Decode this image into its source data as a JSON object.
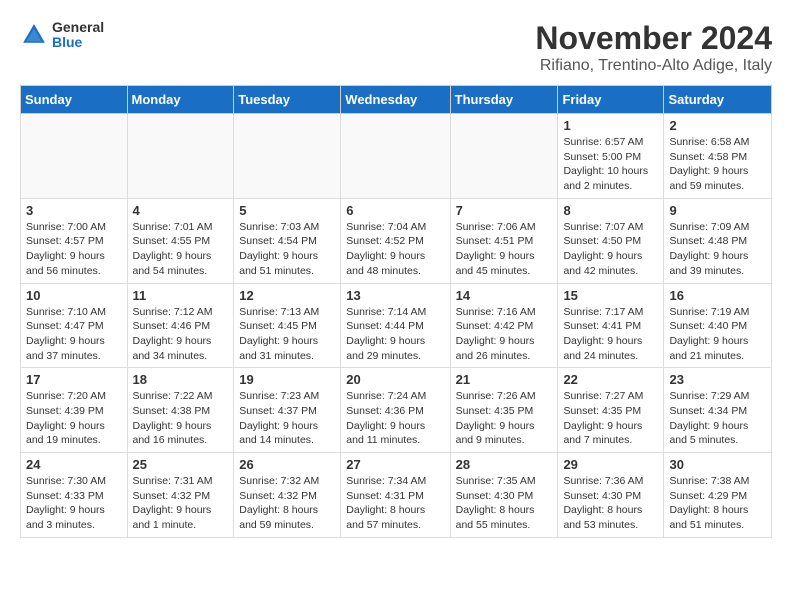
{
  "header": {
    "logo_general": "General",
    "logo_blue": "Blue",
    "month_title": "November 2024",
    "location": "Rifiano, Trentino-Alto Adige, Italy"
  },
  "weekdays": [
    "Sunday",
    "Monday",
    "Tuesday",
    "Wednesday",
    "Thursday",
    "Friday",
    "Saturday"
  ],
  "weeks": [
    [
      {
        "day": "",
        "info": ""
      },
      {
        "day": "",
        "info": ""
      },
      {
        "day": "",
        "info": ""
      },
      {
        "day": "",
        "info": ""
      },
      {
        "day": "",
        "info": ""
      },
      {
        "day": "1",
        "info": "Sunrise: 6:57 AM\nSunset: 5:00 PM\nDaylight: 10 hours and 2 minutes."
      },
      {
        "day": "2",
        "info": "Sunrise: 6:58 AM\nSunset: 4:58 PM\nDaylight: 9 hours and 59 minutes."
      }
    ],
    [
      {
        "day": "3",
        "info": "Sunrise: 7:00 AM\nSunset: 4:57 PM\nDaylight: 9 hours and 56 minutes."
      },
      {
        "day": "4",
        "info": "Sunrise: 7:01 AM\nSunset: 4:55 PM\nDaylight: 9 hours and 54 minutes."
      },
      {
        "day": "5",
        "info": "Sunrise: 7:03 AM\nSunset: 4:54 PM\nDaylight: 9 hours and 51 minutes."
      },
      {
        "day": "6",
        "info": "Sunrise: 7:04 AM\nSunset: 4:52 PM\nDaylight: 9 hours and 48 minutes."
      },
      {
        "day": "7",
        "info": "Sunrise: 7:06 AM\nSunset: 4:51 PM\nDaylight: 9 hours and 45 minutes."
      },
      {
        "day": "8",
        "info": "Sunrise: 7:07 AM\nSunset: 4:50 PM\nDaylight: 9 hours and 42 minutes."
      },
      {
        "day": "9",
        "info": "Sunrise: 7:09 AM\nSunset: 4:48 PM\nDaylight: 9 hours and 39 minutes."
      }
    ],
    [
      {
        "day": "10",
        "info": "Sunrise: 7:10 AM\nSunset: 4:47 PM\nDaylight: 9 hours and 37 minutes."
      },
      {
        "day": "11",
        "info": "Sunrise: 7:12 AM\nSunset: 4:46 PM\nDaylight: 9 hours and 34 minutes."
      },
      {
        "day": "12",
        "info": "Sunrise: 7:13 AM\nSunset: 4:45 PM\nDaylight: 9 hours and 31 minutes."
      },
      {
        "day": "13",
        "info": "Sunrise: 7:14 AM\nSunset: 4:44 PM\nDaylight: 9 hours and 29 minutes."
      },
      {
        "day": "14",
        "info": "Sunrise: 7:16 AM\nSunset: 4:42 PM\nDaylight: 9 hours and 26 minutes."
      },
      {
        "day": "15",
        "info": "Sunrise: 7:17 AM\nSunset: 4:41 PM\nDaylight: 9 hours and 24 minutes."
      },
      {
        "day": "16",
        "info": "Sunrise: 7:19 AM\nSunset: 4:40 PM\nDaylight: 9 hours and 21 minutes."
      }
    ],
    [
      {
        "day": "17",
        "info": "Sunrise: 7:20 AM\nSunset: 4:39 PM\nDaylight: 9 hours and 19 minutes."
      },
      {
        "day": "18",
        "info": "Sunrise: 7:22 AM\nSunset: 4:38 PM\nDaylight: 9 hours and 16 minutes."
      },
      {
        "day": "19",
        "info": "Sunrise: 7:23 AM\nSunset: 4:37 PM\nDaylight: 9 hours and 14 minutes."
      },
      {
        "day": "20",
        "info": "Sunrise: 7:24 AM\nSunset: 4:36 PM\nDaylight: 9 hours and 11 minutes."
      },
      {
        "day": "21",
        "info": "Sunrise: 7:26 AM\nSunset: 4:35 PM\nDaylight: 9 hours and 9 minutes."
      },
      {
        "day": "22",
        "info": "Sunrise: 7:27 AM\nSunset: 4:35 PM\nDaylight: 9 hours and 7 minutes."
      },
      {
        "day": "23",
        "info": "Sunrise: 7:29 AM\nSunset: 4:34 PM\nDaylight: 9 hours and 5 minutes."
      }
    ],
    [
      {
        "day": "24",
        "info": "Sunrise: 7:30 AM\nSunset: 4:33 PM\nDaylight: 9 hours and 3 minutes."
      },
      {
        "day": "25",
        "info": "Sunrise: 7:31 AM\nSunset: 4:32 PM\nDaylight: 9 hours and 1 minute."
      },
      {
        "day": "26",
        "info": "Sunrise: 7:32 AM\nSunset: 4:32 PM\nDaylight: 8 hours and 59 minutes."
      },
      {
        "day": "27",
        "info": "Sunrise: 7:34 AM\nSunset: 4:31 PM\nDaylight: 8 hours and 57 minutes."
      },
      {
        "day": "28",
        "info": "Sunrise: 7:35 AM\nSunset: 4:30 PM\nDaylight: 8 hours and 55 minutes."
      },
      {
        "day": "29",
        "info": "Sunrise: 7:36 AM\nSunset: 4:30 PM\nDaylight: 8 hours and 53 minutes."
      },
      {
        "day": "30",
        "info": "Sunrise: 7:38 AM\nSunset: 4:29 PM\nDaylight: 8 hours and 51 minutes."
      }
    ]
  ]
}
